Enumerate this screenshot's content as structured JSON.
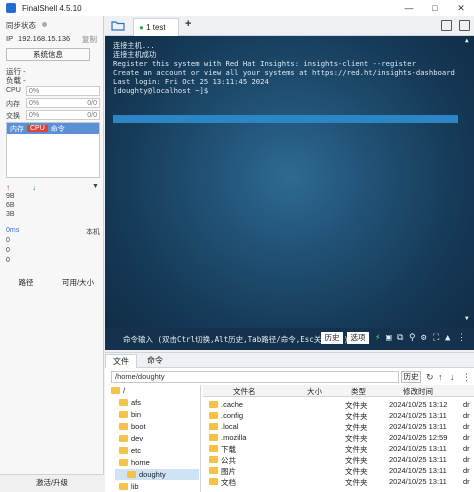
{
  "window": {
    "title": "FinalShell 4.5.10"
  },
  "left": {
    "sync_label": "同步状态",
    "ip_label": "IP",
    "ip_value": "192.168.15.136",
    "copy_label": "复制",
    "sysinfo_button": "系统信息",
    "running_label": "运行 -",
    "load_label": "负载 -",
    "meters": [
      {
        "label": "CPU",
        "pct": "0%",
        "right": ""
      },
      {
        "label": "内存",
        "pct": "0%",
        "right": "0/0"
      },
      {
        "label": "交换",
        "pct": "0%",
        "right": "0/0"
      }
    ],
    "proc_tabs": [
      "内存",
      "CPU",
      "命令"
    ],
    "net_values": [
      "9B",
      "6B",
      "3B"
    ],
    "latency_label": "0ms",
    "latency_right": "本机",
    "latency_values": [
      "0",
      "0",
      "0"
    ],
    "btn_path": "路径",
    "btn_size": "可用/大小",
    "activate": "激活/升级"
  },
  "tabs": {
    "active_tab": "1 test",
    "add": "+"
  },
  "terminal": {
    "lines": [
      "连接主机...",
      "连接主机成功",
      "Register this system with Red Hat Insights: insights-client --register",
      "Create an account or view all your systems at https://red.ht/insights-dashboard",
      "Last login: Fri Oct 25 13:11:45 2024",
      "[doughty@localhost ~]$"
    ],
    "cmd_placeholder": "命令输入 (双击Ctrl切换,Alt历史,Tab路径/命令,Esc关闭窗口)",
    "history_btn": "历史",
    "options_btn": "选项",
    "colors": {
      "bg": "#1f4f72",
      "highlight": "#2d86c4"
    }
  },
  "files": {
    "tabs": [
      "文件",
      "命令"
    ],
    "path": "/home/doughty",
    "history_btn": "历史",
    "tree": [
      {
        "name": "/",
        "indent": 0,
        "selected": false
      },
      {
        "name": "afs",
        "indent": 1,
        "selected": false
      },
      {
        "name": "bin",
        "indent": 1,
        "selected": false
      },
      {
        "name": "boot",
        "indent": 1,
        "selected": false
      },
      {
        "name": "dev",
        "indent": 1,
        "selected": false
      },
      {
        "name": "etc",
        "indent": 1,
        "selected": false
      },
      {
        "name": "home",
        "indent": 1,
        "selected": false
      },
      {
        "name": "doughty",
        "indent": 2,
        "selected": true
      },
      {
        "name": "lib",
        "indent": 1,
        "selected": false
      }
    ],
    "columns": [
      "文件名",
      "大小",
      "类型",
      "修改时间"
    ],
    "rows": [
      {
        "name": ".cache",
        "size": "",
        "type": "文件夹",
        "mtime": "2024/10/25 13:12",
        "extra": "dr"
      },
      {
        "name": ".config",
        "size": "",
        "type": "文件夹",
        "mtime": "2024/10/25 13:11",
        "extra": "dr"
      },
      {
        "name": ".local",
        "size": "",
        "type": "文件夹",
        "mtime": "2024/10/25 13:11",
        "extra": "dr"
      },
      {
        "name": ".mozilla",
        "size": "",
        "type": "文件夹",
        "mtime": "2024/10/25 12:59",
        "extra": "dr"
      },
      {
        "name": "下载",
        "size": "",
        "type": "文件夹",
        "mtime": "2024/10/25 13:11",
        "extra": "dr"
      },
      {
        "name": "公共",
        "size": "",
        "type": "文件夹",
        "mtime": "2024/10/25 13:11",
        "extra": "dr"
      },
      {
        "name": "图片",
        "size": "",
        "type": "文件夹",
        "mtime": "2024/10/25 13:11",
        "extra": "dr"
      },
      {
        "name": "文档",
        "size": "",
        "type": "文件夹",
        "mtime": "2024/10/25 13:11",
        "extra": "dr"
      }
    ]
  }
}
